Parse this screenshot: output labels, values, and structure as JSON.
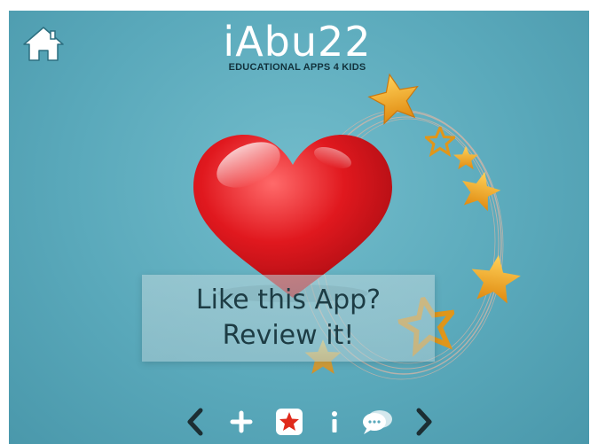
{
  "logo": {
    "title": "iAbu22",
    "subtitle": "EDUCATIONAL APPS 4 KIDS"
  },
  "prompt": {
    "line1": "Like this App?",
    "line2": "Review it!"
  },
  "icons": {
    "home": "home-icon",
    "previous": "chevron-left-icon",
    "more_apps": "plus-icon",
    "review": "star-icon",
    "info": "info-icon",
    "feedback": "chat-bubble-icon",
    "next": "chevron-right-icon"
  },
  "colors": {
    "background": "#5aa9bb",
    "heart": "#d8191f",
    "star": "#f2a81c",
    "banner_text": "#1d3c44",
    "review_icon_star": "#e02a1b"
  }
}
